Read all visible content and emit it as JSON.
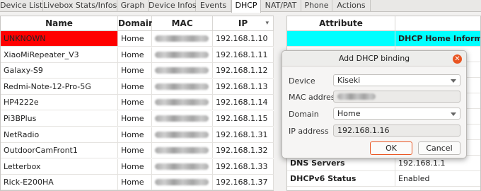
{
  "tabs": [
    {
      "label": "Device List",
      "active": false
    },
    {
      "label": "Livebox Stats/Infos",
      "active": false
    },
    {
      "label": "Graph",
      "active": false
    },
    {
      "label": "Device Infos",
      "active": false
    },
    {
      "label": "Events",
      "active": false
    },
    {
      "label": "DHCP",
      "active": true
    },
    {
      "label": "NAT/PAT",
      "active": false
    },
    {
      "label": "Phone",
      "active": false
    },
    {
      "label": "Actions",
      "active": false
    }
  ],
  "left_table": {
    "columns": [
      "Name",
      "Domain",
      "MAC",
      "IP"
    ],
    "ip_sort_indicator": "▾",
    "rows": [
      {
        "name": "UNKNOWN",
        "domain": "Home",
        "ip": "192.168.1.10",
        "highlight": "#ff0000"
      },
      {
        "name": "XiaoMiRepeater_V3",
        "domain": "Home",
        "ip": "192.168.1.11"
      },
      {
        "name": "Galaxy-S9",
        "domain": "Home",
        "ip": "192.168.1.12"
      },
      {
        "name": "Redmi-Note-12-Pro-5G",
        "domain": "Home",
        "ip": "192.168.1.13"
      },
      {
        "name": "HP4222e",
        "domain": "Home",
        "ip": "192.168.1.14"
      },
      {
        "name": "Pi3BPlus",
        "domain": "Home",
        "ip": "192.168.1.15"
      },
      {
        "name": "NetRadio",
        "domain": "Home",
        "ip": "192.168.1.31"
      },
      {
        "name": "OutdoorCamFront1",
        "domain": "Home",
        "ip": "192.168.1.32"
      },
      {
        "name": "Letterbox",
        "domain": "Home",
        "ip": "192.168.1.33"
      },
      {
        "name": "Rick-E200HA",
        "domain": "Home",
        "ip": "192.168.1.37"
      }
    ]
  },
  "right_table": {
    "columns": [
      "Attribute",
      ""
    ],
    "header_row": {
      "attribute": "",
      "value": "DHCP Home Information",
      "highlight": "#00ffff"
    },
    "rows": [
      {
        "attribute": "DNS Servers",
        "value": "192.168.1.1"
      },
      {
        "attribute": "DHCPv6 Status",
        "value": "Enabled"
      }
    ]
  },
  "dialog": {
    "title": "Add DHCP binding",
    "device_label": "Device",
    "device_value": "Kiseki",
    "mac_label": "MAC address",
    "domain_label": "Domain",
    "domain_value": "Home",
    "ip_label": "IP address",
    "ip_value": "192.168.1.16",
    "ok_label": "OK",
    "cancel_label": "Cancel",
    "close_glyph": "✕"
  },
  "colors": {
    "accent": "#e95420",
    "unknown_row": "#ff0000",
    "info_row": "#00ffff"
  }
}
